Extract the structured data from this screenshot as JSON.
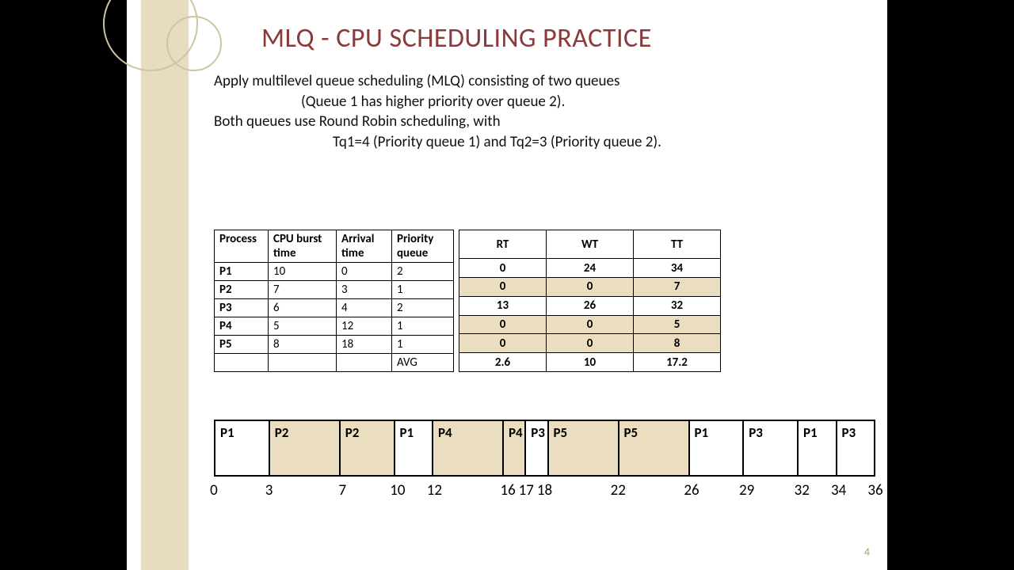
{
  "title": "MLQ - CPU SCHEDULING  PRACTICE",
  "desc": {
    "l1": "Apply multilevel queue scheduling (MLQ) consisting of two queues",
    "l2": "(Queue 1 has higher priority over queue 2).",
    "l3": "Both queues use Round Robin scheduling, with",
    "l4": "Tq1=4 (Priority queue 1) and Tq2=3 (Priority queue 2)."
  },
  "left_headers": {
    "h1": "Process",
    "h2": "CPU burst time",
    "h3": "Arrival time",
    "h4": "Priority queue"
  },
  "left_rows": [
    {
      "p": "P1",
      "b": "10",
      "a": "0",
      "q": "2"
    },
    {
      "p": "P2",
      "b": "7",
      "a": "3",
      "q": "1"
    },
    {
      "p": "P3",
      "b": "6",
      "a": "4",
      "q": "2"
    },
    {
      "p": "P4",
      "b": "5",
      "a": "12",
      "q": "1"
    },
    {
      "p": "P5",
      "b": "8",
      "a": "18",
      "q": "1"
    }
  ],
  "avg_label": "AVG",
  "right_headers": {
    "h1": "RT",
    "h2": "WT",
    "h3": "TT"
  },
  "right_rows": [
    {
      "rt": "0",
      "wt": "24",
      "tt": "34",
      "shade": false
    },
    {
      "rt": "0",
      "wt": "0",
      "tt": "7",
      "shade": true
    },
    {
      "rt": "13",
      "wt": "26",
      "tt": "32",
      "shade": false
    },
    {
      "rt": "0",
      "wt": "0",
      "tt": "5",
      "shade": true
    },
    {
      "rt": "0",
      "wt": "0",
      "tt": "8",
      "shade": true
    },
    {
      "rt": "2.6",
      "wt": "10",
      "tt": "17.2",
      "shade": false
    }
  ],
  "gantt": [
    {
      "l": "P1",
      "w": 3,
      "shade": false
    },
    {
      "l": "P2",
      "w": 4,
      "shade": true
    },
    {
      "l": "P2",
      "w": 3,
      "shade": true
    },
    {
      "l": "P1",
      "w": 2,
      "shade": false
    },
    {
      "l": "P4",
      "w": 4,
      "shade": true
    },
    {
      "l": "P4",
      "w": 1,
      "shade": true
    },
    {
      "l": "P3",
      "w": 1,
      "shade": false
    },
    {
      "l": "P5",
      "w": 4,
      "shade": true
    },
    {
      "l": "P5",
      "w": 4,
      "shade": true
    },
    {
      "l": "P1",
      "w": 3,
      "shade": false
    },
    {
      "l": "P3",
      "w": 3,
      "shade": false
    },
    {
      "l": "P1",
      "w": 2,
      "shade": false
    },
    {
      "l": "P3",
      "w": 2,
      "shade": false
    }
  ],
  "ticks": [
    "0",
    "3",
    "7",
    "10",
    "12",
    "16",
    "17",
    "18",
    "22",
    "26",
    "29",
    "32",
    "34",
    "36"
  ],
  "total_units": 36,
  "pagenum": "4"
}
